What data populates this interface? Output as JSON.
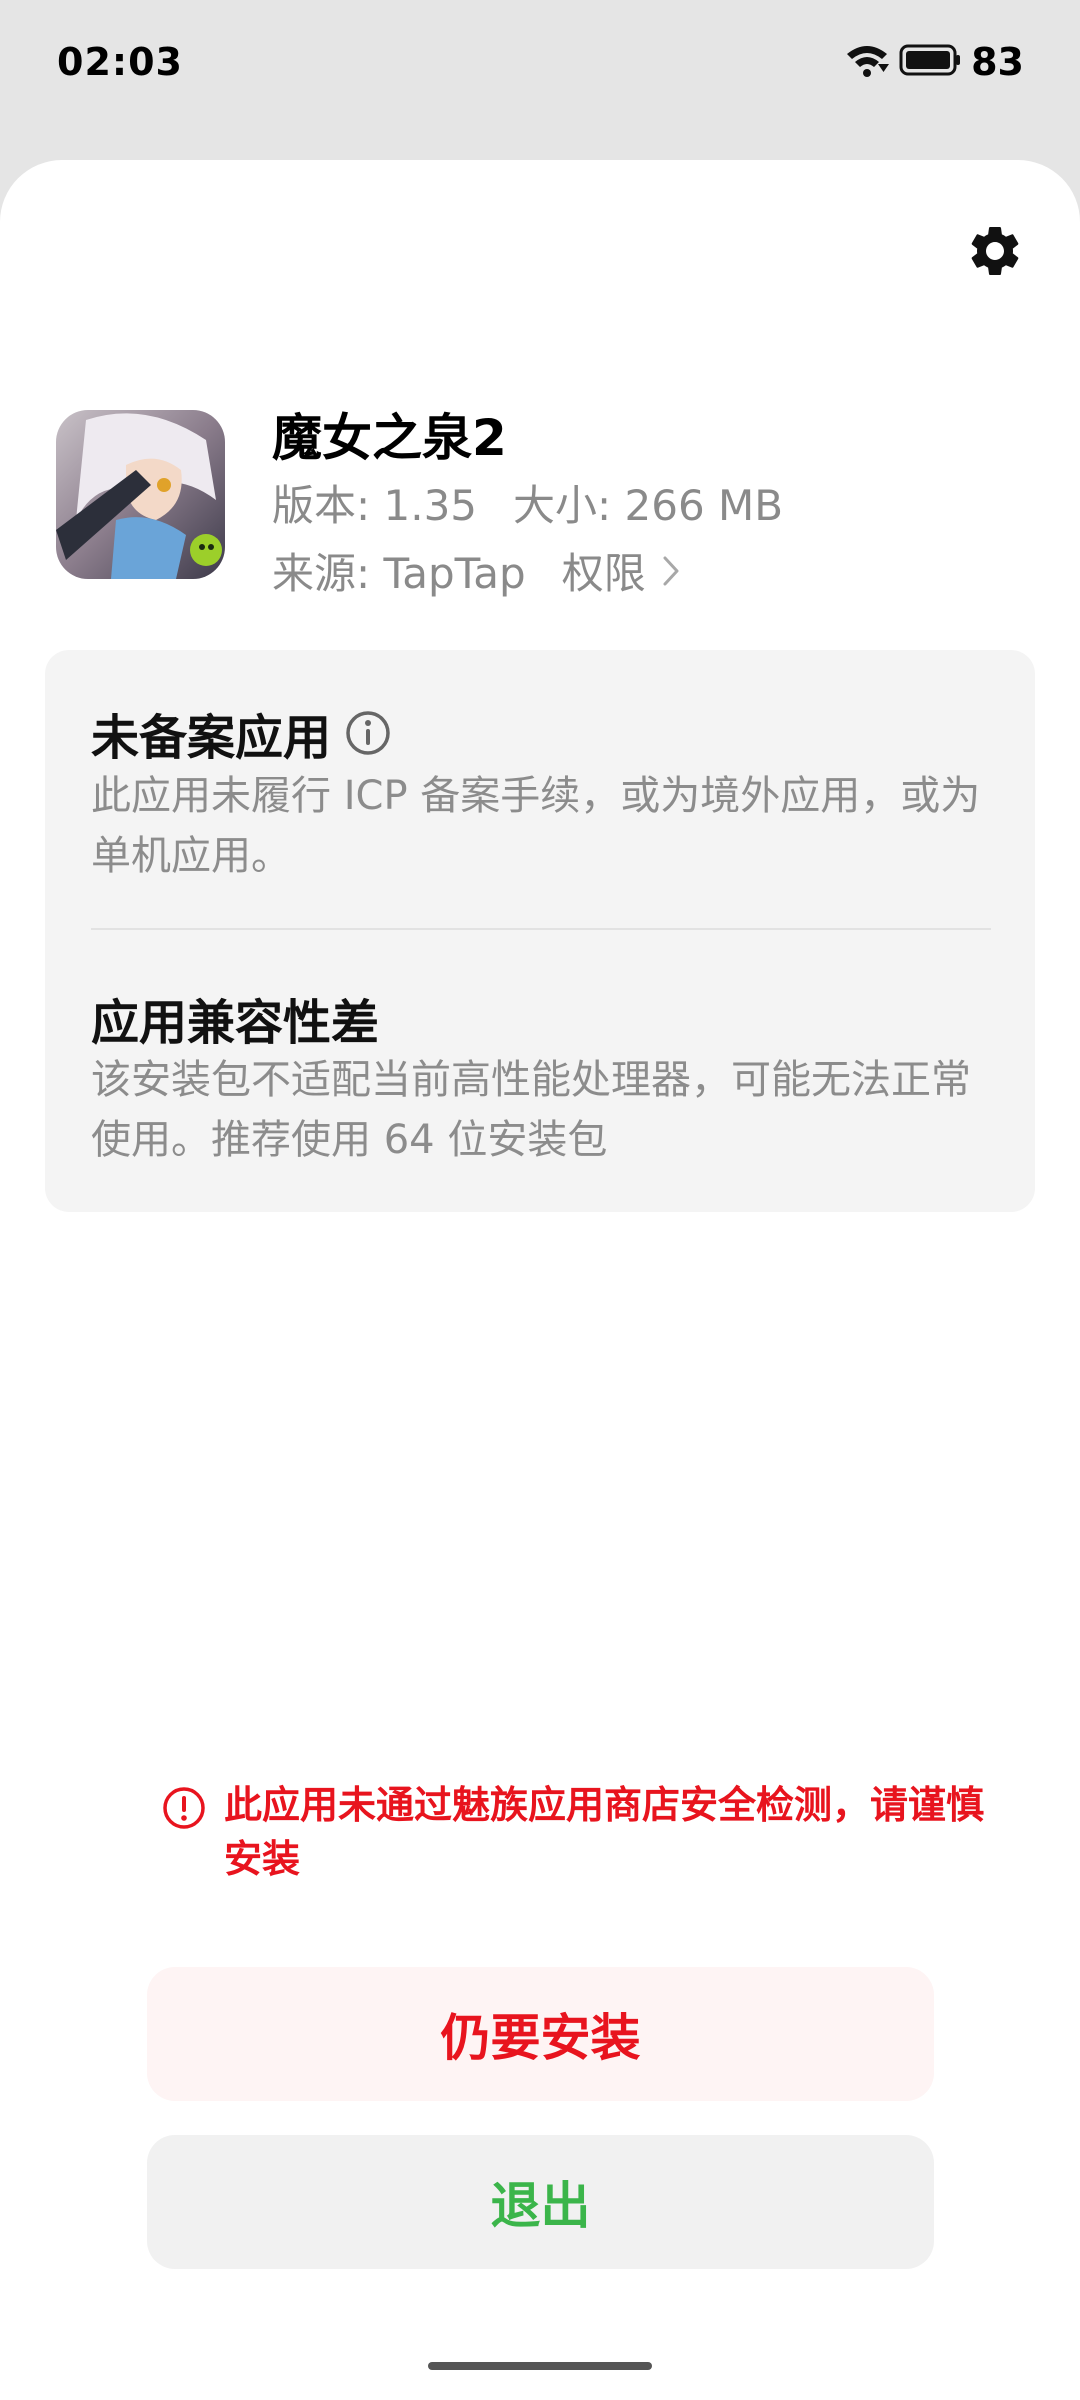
{
  "status_bar": {
    "time": "02:03",
    "battery_level": "83",
    "icons": [
      "wifi-icon",
      "battery-icon"
    ]
  },
  "header": {
    "settings_icon": "gear-icon"
  },
  "app": {
    "name": "魔女之泉2",
    "version": "版本: 1.35",
    "size": "大小: 266 MB",
    "source": "来源: TapTap",
    "permissions_label": "权限"
  },
  "info_card": {
    "unregistered": {
      "title": "未备案应用",
      "description": "此应用未履行 ICP 备案手续，或为境外应用，或为单机应用。"
    },
    "compatibility": {
      "title": "应用兼容性差",
      "description": "该安装包不适配当前高性能处理器，可能无法正常使用。推荐使用 64 位安装包"
    }
  },
  "warning": {
    "text": "此应用未通过魅族应用商店安全检测，请谨慎安装"
  },
  "actions": {
    "install_label": "仍要安装",
    "exit_label": "退出"
  },
  "colors": {
    "warning_red": "#e8141e",
    "exit_green": "#3bb54a",
    "card_bg": "#f4f4f4"
  }
}
